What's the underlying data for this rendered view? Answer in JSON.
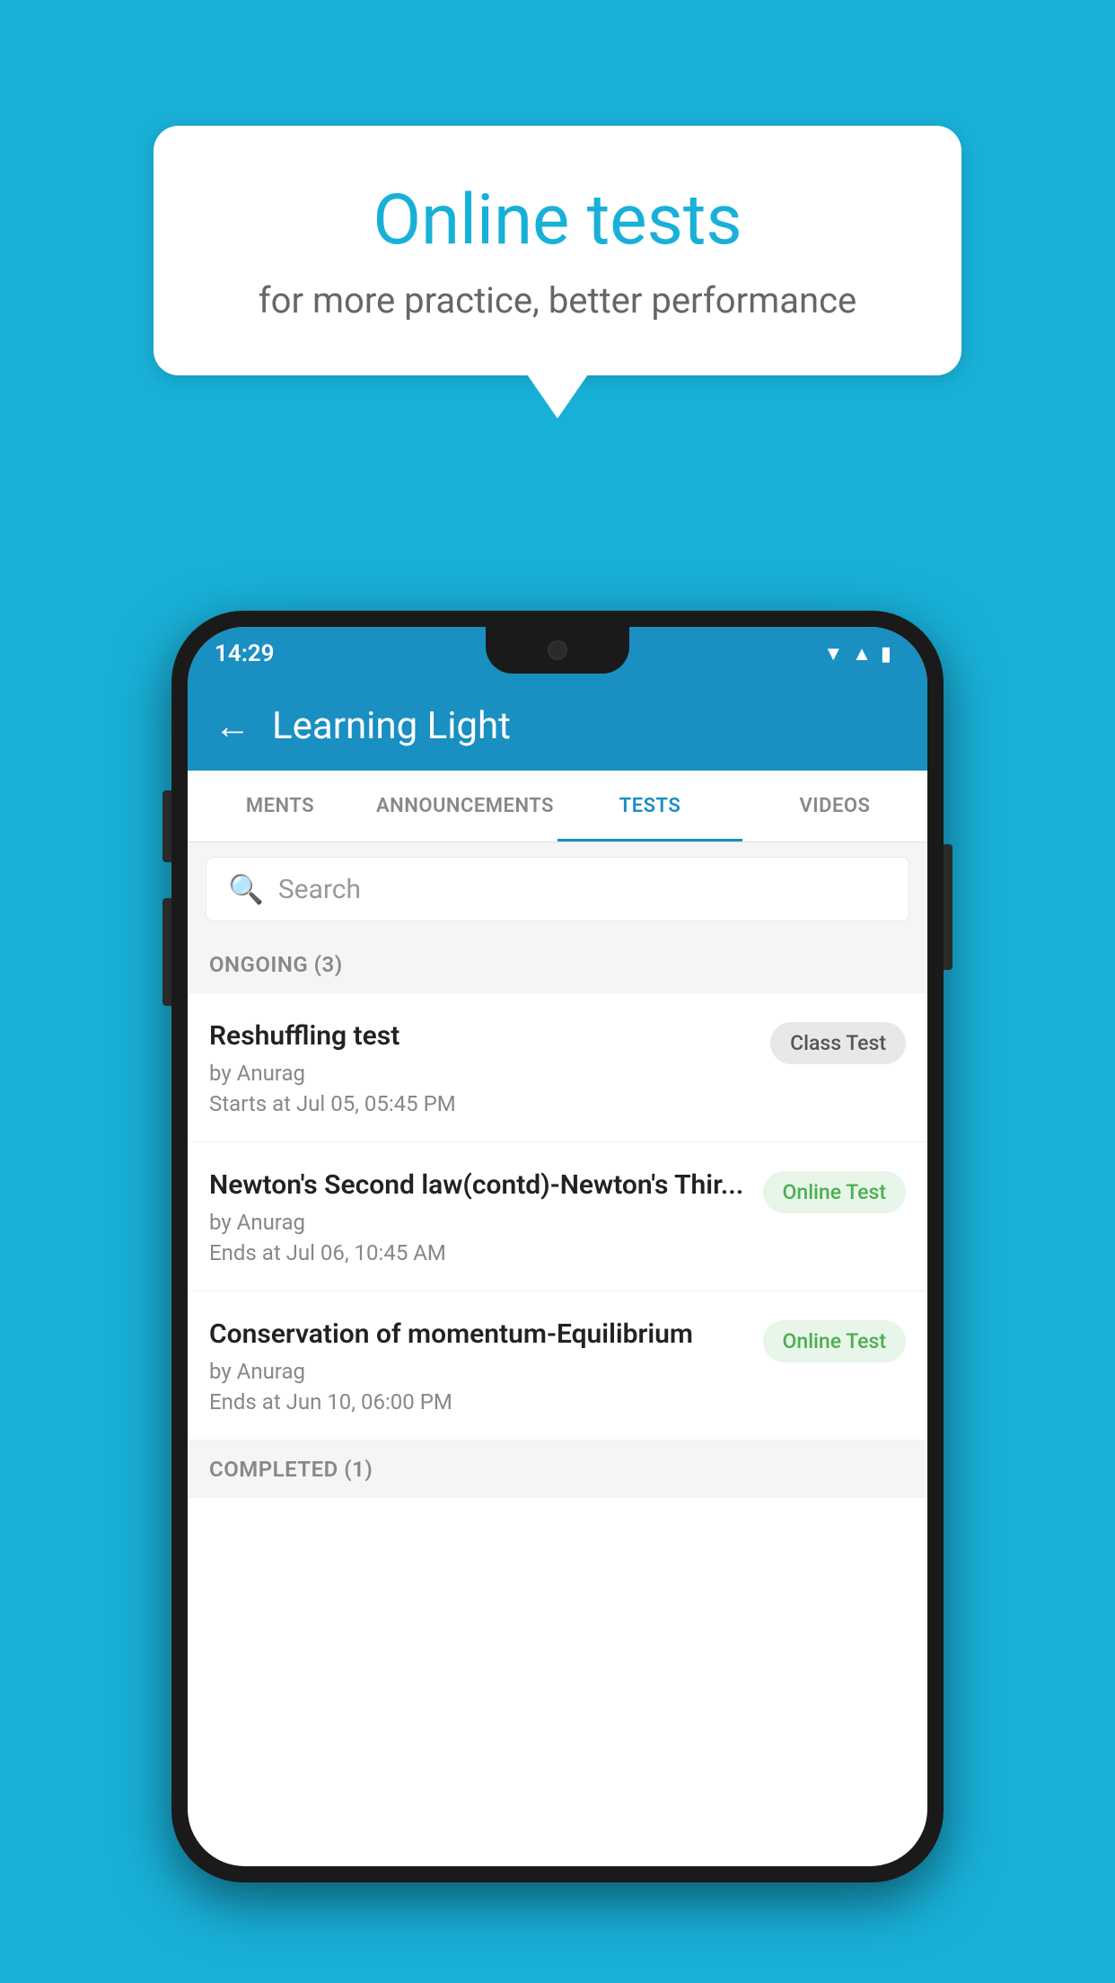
{
  "background": {
    "color": "#19B0D8"
  },
  "speech_bubble": {
    "title": "Online tests",
    "subtitle": "for more practice, better performance"
  },
  "phone": {
    "status_bar": {
      "time": "14:29",
      "icons": [
        "wifi",
        "signal",
        "battery"
      ]
    },
    "header": {
      "back_label": "←",
      "title": "Learning Light"
    },
    "tabs": [
      {
        "label": "MENTS",
        "active": false
      },
      {
        "label": "ANNOUNCEMENTS",
        "active": false
      },
      {
        "label": "TESTS",
        "active": true
      },
      {
        "label": "VIDEOS",
        "active": false
      }
    ],
    "search": {
      "placeholder": "Search"
    },
    "ongoing_section": {
      "label": "ONGOING (3)"
    },
    "test_items": [
      {
        "name": "Reshuffling test",
        "by": "by Anurag",
        "time_label": "Starts at",
        "time": "Jul 05, 05:45 PM",
        "badge": "Class Test",
        "badge_type": "class"
      },
      {
        "name": "Newton's Second law(contd)-Newton's Thir...",
        "by": "by Anurag",
        "time_label": "Ends at",
        "time": "Jul 06, 10:45 AM",
        "badge": "Online Test",
        "badge_type": "online"
      },
      {
        "name": "Conservation of momentum-Equilibrium",
        "by": "by Anurag",
        "time_label": "Ends at",
        "time": "Jun 10, 06:00 PM",
        "badge": "Online Test",
        "badge_type": "online"
      }
    ],
    "completed_section": {
      "label": "COMPLETED (1)"
    }
  }
}
